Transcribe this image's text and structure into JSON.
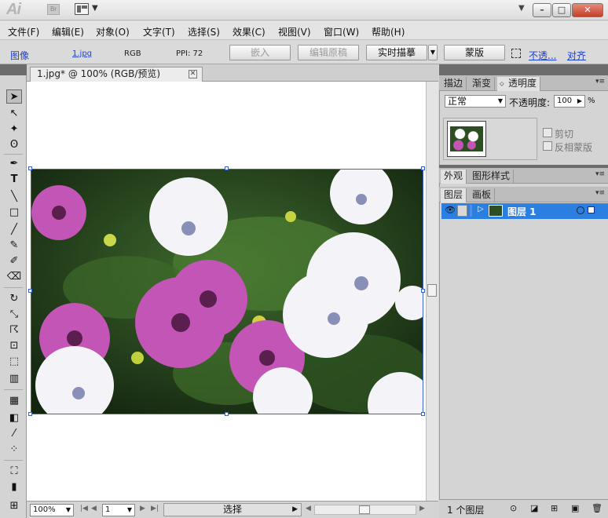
{
  "app": {
    "logo": "Ai",
    "bridge": "Br"
  },
  "menu": [
    "文件(F)",
    "编辑(E)",
    "对象(O)",
    "文字(T)",
    "选择(S)",
    "效果(C)",
    "视图(V)",
    "窗口(W)",
    "帮助(H)"
  ],
  "control_bar": {
    "object_type": "图像",
    "file_link": "1.jpg",
    "color_mode": "RGB",
    "ppi": "PPI: 72",
    "embed": "嵌入",
    "edit_original": "编辑原稿",
    "live_trace": "实时描摹",
    "mask": "蒙版",
    "opacity_link": "不透...",
    "align_link": "对齐"
  },
  "document": {
    "tab_title": "1.jpg* @ 100% (RGB/预览)",
    "zoom": "100%",
    "page": "1",
    "status": "选择"
  },
  "transparency_panel": {
    "tabs": [
      "描边",
      "渐变",
      "透明度"
    ],
    "blend_mode": "正常",
    "opacity_label": "不透明度:",
    "opacity_value": "100",
    "opacity_unit": "%",
    "clip_label": "剪切",
    "invert_mask_label": "反相蒙版"
  },
  "appearance_panel": {
    "tabs": [
      "外观",
      "图形样式"
    ]
  },
  "layers_panel": {
    "tabs": [
      "图层",
      "画板"
    ],
    "layer_name": "图层 1",
    "count": "1 个图层"
  },
  "colors": {
    "selection_blue": "#3b63cc",
    "layer_highlight": "#2a7fe0",
    "link_blue": "#1c3fd4"
  }
}
